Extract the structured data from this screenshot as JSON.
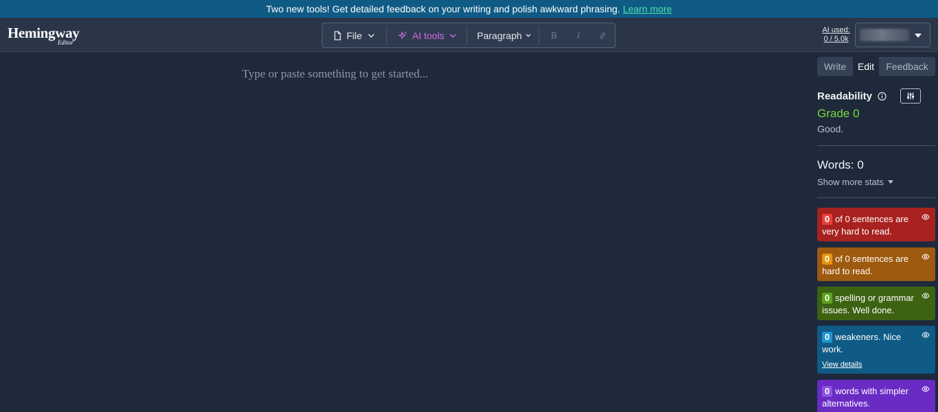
{
  "banner": {
    "text": "Two new tools! Get detailed feedback on your writing and polish awkward phrasing.",
    "link": "Learn more"
  },
  "header": {
    "logo": "Hemingway",
    "logo_sub": "Editor",
    "toolbar": {
      "file": "File",
      "ai_tools": "AI tools",
      "paragraph": "Paragraph",
      "bold": "B",
      "italic": "I"
    },
    "ai_used_label": "AI used:",
    "ai_used_value": "0 / 5.0k"
  },
  "editor": {
    "placeholder": "Type or paste something to get started..."
  },
  "sidebar": {
    "modes": [
      "Write",
      "Edit",
      "Feedback"
    ],
    "active_mode": "Edit",
    "readability_label": "Readability",
    "grade": "Grade 0",
    "grade_comment": "Good.",
    "words": "Words: 0",
    "show_more": "Show more stats",
    "cards": [
      {
        "count": "0",
        "text": "of 0 sentences are very hard to read.",
        "color": "#a8221f"
      },
      {
        "count": "0",
        "text": "of 0 sentences are hard to read.",
        "color": "#9e5a0f"
      },
      {
        "count": "0",
        "text": "spelling or grammar issues. Well done.",
        "color": "#3d6212"
      },
      {
        "count": "0",
        "text": "weakeners. Nice work.",
        "link": "View details",
        "color": "#0f5b85"
      },
      {
        "count": "0",
        "text": "words with simpler alternatives.",
        "color": "#6a2bc4"
      }
    ]
  },
  "colors": {
    "background": "#1e2a3b",
    "header": "#2a3648",
    "banner": "#0f5b85",
    "ai_accent": "#d36ae9",
    "grade_green": "#7cd63a"
  }
}
